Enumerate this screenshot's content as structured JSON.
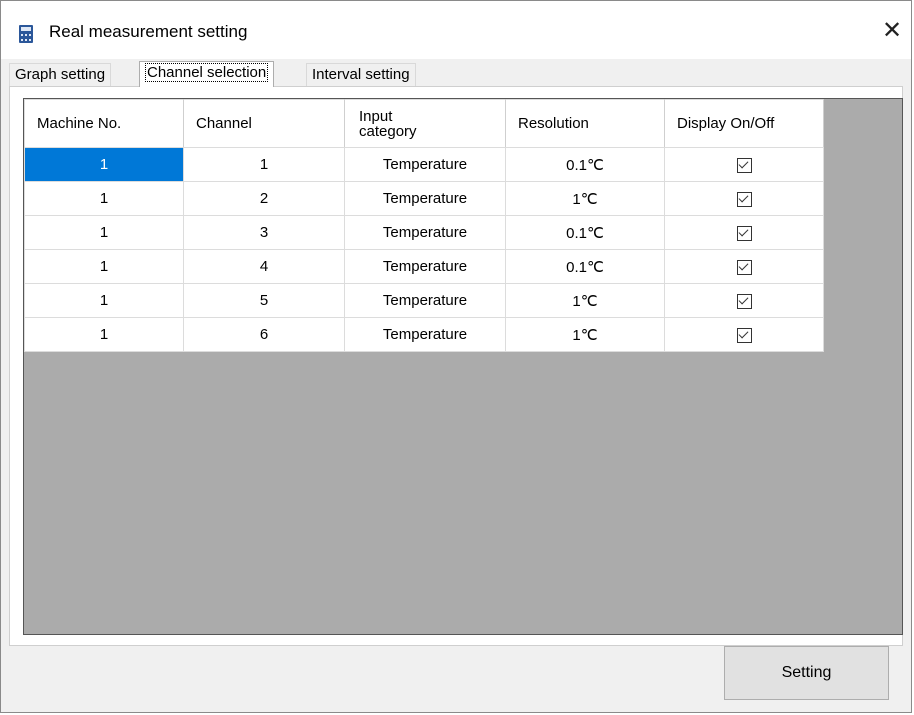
{
  "window": {
    "title": "Real measurement setting",
    "close_glyph": "✕"
  },
  "tabs": [
    {
      "label": "Graph setting",
      "active": false
    },
    {
      "label": "Channel selection",
      "active": true
    },
    {
      "label": "Interval setting",
      "active": false
    }
  ],
  "grid": {
    "columns": [
      "Machine No.",
      "Channel",
      "Input\ncategory",
      "Resolution",
      "Display On/Off"
    ],
    "rows": [
      {
        "machine": "1",
        "channel": "1",
        "category": "Temperature",
        "resolution": "0.1℃",
        "display": true
      },
      {
        "machine": "1",
        "channel": "2",
        "category": "Temperature",
        "resolution": "1℃",
        "display": true
      },
      {
        "machine": "1",
        "channel": "3",
        "category": "Temperature",
        "resolution": "0.1℃",
        "display": true
      },
      {
        "machine": "1",
        "channel": "4",
        "category": "Temperature",
        "resolution": "0.1℃",
        "display": true
      },
      {
        "machine": "1",
        "channel": "5",
        "category": "Temperature",
        "resolution": "1℃",
        "display": true
      },
      {
        "machine": "1",
        "channel": "6",
        "category": "Temperature",
        "resolution": "1℃",
        "display": true
      }
    ],
    "selected_color": "#0078d7",
    "empty_area_color": "#ababab"
  },
  "footer": {
    "setting_label": "Setting"
  },
  "icons": {
    "app": "calculator-icon",
    "close": "close-icon",
    "checkbox": "checkbox-checked-icon"
  }
}
